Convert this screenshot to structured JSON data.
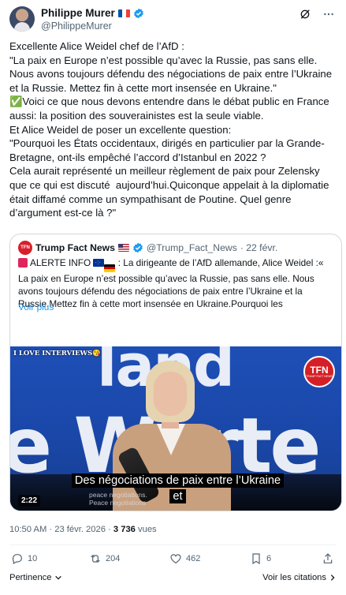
{
  "author": {
    "display_name": "Philippe Murer",
    "handle": "@PhilippeMurer",
    "flag_colors": [
      "#0055a4",
      "#ffffff",
      "#ef4135"
    ]
  },
  "header_icons": [
    "grok-icon",
    "more-icon"
  ],
  "tweet_text": "Excellente Alice Weidel chef de l’AfD :\n\"La paix en Europe n’est possible qu’avec la Russie, pas sans elle. Nous avons toujours défendu des négociations de paix entre l’Ukraine et la Russie. Mettez fin à cette mort insensée en Ukraine.\"\n✅Voici ce que nous devons entendre dans le débat public en France aussi: la position des souverainistes est la seule viable.\nEt Alice Weidel de poser un excellente question:\n\"Pourquoi les États occidentaux, dirigés en particulier par la Grande-Bretagne, ont-ils empêché l’accord d’Istanbul en 2022 ?\nCela aurait représenté un meilleur règlement de paix pour Zelensky que ce qui est discuté  aujourd’hui.Quiconque appelait à la diplomatie était diffamé comme un sympathisant de Poutine. Quel genre d’argument est-ce là ?\"",
  "quote": {
    "avatar_text": "TFN",
    "name": "Trump Fact News",
    "handle": "@Trump_Fact_News",
    "date": "· 22 févr.",
    "alert_label": "ALERTE INFO",
    "text_rest": " : La dirigeante de l’AfD allemande, Alice Weidel :« La paix en Europe n’est possible qu’avec la Russie, pas sans elle. Nous avons toujours défendu des négociations de paix entre l’Ukraine et la Russie.Mettez fin à cette mort insensée en Ukraine.Pourquoi les",
    "show_more": "Voir plus",
    "video": {
      "background_line_1": "land",
      "background_line_2": "e Werte",
      "overlay_text": "I LOVE INTERVIEWS",
      "logo_main": "TFN",
      "logo_sub": "TRUMP FACT NEWS",
      "subtitle_line_1": "Des négociations de paix entre l’Ukraine",
      "subtitle_line_2": "et",
      "small_caption": "peace negotiations.\nPeace negotiations",
      "duration": "2:22"
    }
  },
  "meta": {
    "time": "10:50 AM",
    "sep": " · ",
    "date": "23 févr. 2026",
    "views_count": "3 736",
    "views_label": " vues"
  },
  "actions": {
    "replies": "10",
    "reposts": "204",
    "likes": "462",
    "bookmarks": "6"
  },
  "footer": {
    "relevance": "Pertinence",
    "quotes_link": "Voir les citations"
  },
  "colors": {
    "text": "#0f1419",
    "muted": "#536471",
    "link": "#1d9bf0",
    "verified": "#1d9bf0",
    "border": "#cfd9de"
  }
}
